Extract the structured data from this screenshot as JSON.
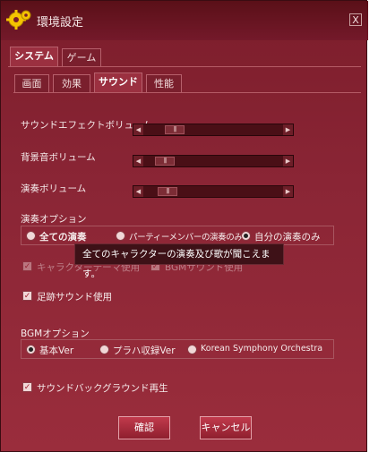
{
  "window": {
    "title": "環境設定",
    "close_label": "X"
  },
  "tabs_top": [
    {
      "label": "システム",
      "active": true
    },
    {
      "label": "ゲーム",
      "active": false
    }
  ],
  "tabs_sub": [
    {
      "label": "画面",
      "active": false
    },
    {
      "label": "効果",
      "active": false
    },
    {
      "label": "サウンド",
      "active": true
    },
    {
      "label": "性能",
      "active": false
    }
  ],
  "sliders": [
    {
      "label": "サウンドエフェクトボリューム",
      "value": 0.18
    },
    {
      "label": "背景音ボリューム",
      "value": 0.1
    },
    {
      "label": "演奏ボリューム",
      "value": 0.12
    }
  ],
  "performance_option": {
    "label": "演奏オプション",
    "options": [
      {
        "label": "全ての演奏",
        "selected": false
      },
      {
        "label": "パーティーメンバーの演奏のみ",
        "selected": false
      },
      {
        "label": "自分の演奏のみ",
        "selected": true
      }
    ],
    "tooltip": "全てのキャラクターの演奏及び歌が聞こえます。"
  },
  "checkboxes_dim": [
    {
      "label": "キャラクターテーマ使用",
      "checked": true
    },
    {
      "label": "BGMサウンド使用",
      "checked": true
    }
  ],
  "footstep": {
    "label": "足跡サウンド使用",
    "checked": true
  },
  "bgm_option": {
    "label": "BGMオプション",
    "options": [
      {
        "label": "基本Ver",
        "selected": true
      },
      {
        "label": "プラハ収録Ver",
        "selected": false
      },
      {
        "label": "Korean Symphony Orchestra",
        "selected": false
      }
    ]
  },
  "background_sound": {
    "label": "サウンドバックグラウンド再生",
    "checked": true
  },
  "buttons": {
    "ok": "確認",
    "cancel": "キャンセル"
  },
  "colors": {
    "window_bg": "#8a2535",
    "accent": "#c13a4c",
    "tooltip_bg": "#3e1117"
  },
  "icons": {
    "title_icon": "gear-icon"
  }
}
